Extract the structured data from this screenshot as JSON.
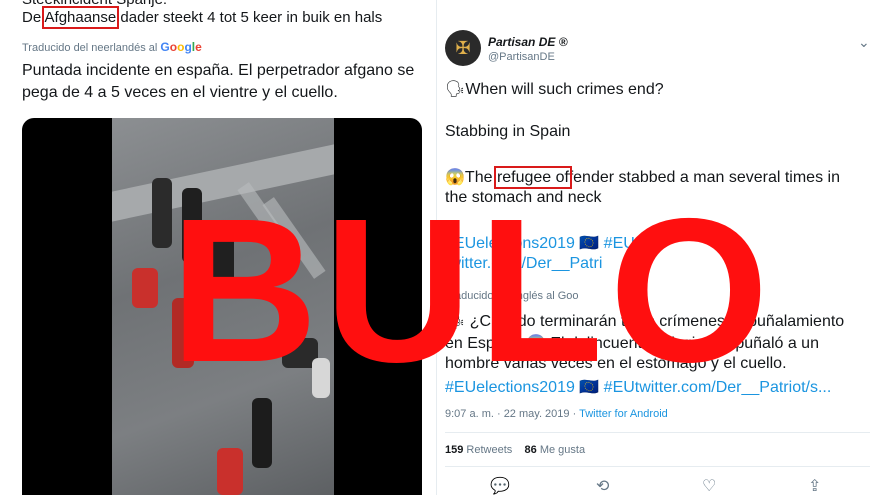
{
  "left_tweet": {
    "cut_text": "Steekincident Spanje:",
    "dutch_before": "De ",
    "dutch_highlight": "Afghaanse",
    "dutch_after": " dader steekt 4 tot 5 keer in buik en hals",
    "translated_label": "Traducido del neerlandés al",
    "google_letters": [
      "G",
      "o",
      "o",
      "g",
      "l",
      "e"
    ],
    "spanish_text": "Puntada incidente en españa. El perpetrador afgano se pega de 4 a 5 veces en el vientre y el cuello."
  },
  "right_tweet": {
    "avatar_icon": "eagle-emblem-icon",
    "name": "Partisan DE ®",
    "handle": "@PartisanDE",
    "line1_icon": "🗣",
    "line1": "When will such crimes end?",
    "line2": "Stabbing in Spain",
    "line3_icon": "😱",
    "line3_before": "The ",
    "line3_highlight": "refugee of",
    "line3_after": "fender stabbed a man several times in",
    "line4": "the stomach and neck",
    "hashtags1": "#EUelections2019 🇪🇺 #EU",
    "link1": "twitter.com/Der__Patri",
    "translated_label": "Traducido del inglés al Goo",
    "es_line1": "🗣 ¿Cuándo terminarán tales crímenes? Apuñalamiento",
    "es_line2": "en España 😱 El delincuente refugiado apuñaló a un",
    "es_line3": "hombre varias veces en el estómago y el cuello.",
    "es_tags": "#EUelections2019 🇪🇺 #EUtwitter.com/Der__Patriot/s...",
    "timestamp": "9:07 a. m. · 22 may. 2019 ·",
    "app": "Twitter for Android",
    "retweets_count": "159",
    "retweets_label": "Retweets",
    "likes_count": "86",
    "likes_label": "Me gusta",
    "actions": [
      "💬",
      "⟲",
      "♡",
      "⇪"
    ]
  },
  "overlay": {
    "stamp": "BULO",
    "stamp_color": "#ff0f0f",
    "highlight_color": "#d91a1a"
  }
}
